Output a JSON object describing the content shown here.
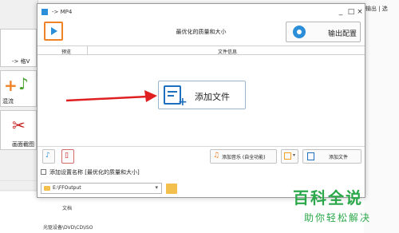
{
  "background": {
    "tiles": [
      {
        "label": "-> 格V"
      },
      {
        "label": "混流"
      },
      {
        "label": "画面截图"
      }
    ],
    "list_items": [
      "文档",
      "光驱设备\\DVD\\CD\\ISO"
    ],
    "right_text": "输出 | 选"
  },
  "dialog": {
    "title": "-> MP4",
    "quality_label": "最优化的质量和大小",
    "output_config_label": "输出配置",
    "columns": {
      "preview": "预览",
      "file_info": "文件信息"
    },
    "add_file_big_label": "添加文件",
    "toolbar": {
      "add_music_label": "添加音乐 (自全功能)",
      "add_file_label": "添加文件"
    },
    "set_name_label": "添加设置名称 [最优化的质量和大小]",
    "path": "E:\\FFOutput",
    "window_controls": {
      "minimize": "_",
      "maximize": "□",
      "close": "×"
    }
  },
  "watermark": {
    "big": "百科全说",
    "small": "助你轻松解决"
  },
  "colors": {
    "accent_blue": "#1e6fbf",
    "arrow_red": "#e02020",
    "film_orange": "#f08228",
    "watermark_green": "#2ba84a"
  }
}
